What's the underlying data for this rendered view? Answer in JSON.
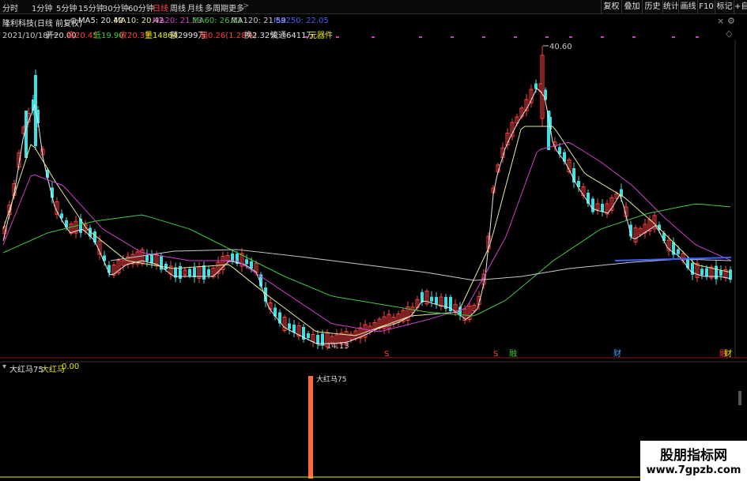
{
  "toolbar": {
    "timeframes": [
      {
        "label": "分时",
        "active": false
      },
      {
        "label": "1分钟",
        "active": false
      },
      {
        "label": "5分钟",
        "active": false
      },
      {
        "label": "15分钟",
        "active": false
      },
      {
        "label": "30分钟",
        "active": false
      },
      {
        "label": "60分钟",
        "active": false
      },
      {
        "label": "日线",
        "active": true
      },
      {
        "label": "周线",
        "active": false
      },
      {
        "label": "月线",
        "active": false
      },
      {
        "label": "多周期",
        "active": false
      },
      {
        "label": "更多",
        "active": false
      }
    ],
    "more_chevron": ">",
    "right_buttons": [
      "复权",
      "叠加",
      "历史",
      "统计",
      "画线",
      "F10",
      "标记",
      "+自"
    ]
  },
  "stock": {
    "name": "隆利科技(日线 前复权)",
    "ma": [
      {
        "label": "MA5: 20.42",
        "color": "#e8e8e8"
      },
      {
        "label": "MA10: 20.42",
        "color": "#e8e8a0"
      },
      {
        "label": "MA20: 21.13",
        "color": "#d040d0"
      },
      {
        "label": "MA60: 26.13",
        "color": "#40c840"
      },
      {
        "label": "MA120: 21.59",
        "color": "#c8c8c8"
      },
      {
        "label": "MA250: 22.05",
        "color": "#4060ff"
      }
    ]
  },
  "quote": {
    "date": "2021/10/18/一",
    "open": "开20.00",
    "high": "高20.45",
    "low": "低19.90",
    "close": "收20.37",
    "volume": "量14864",
    "amount": "额2999万",
    "change": "幅0.26(1.28%)",
    "turnover": "换2.32%",
    "float_shares": "流通6411万",
    "sector": "元器件"
  },
  "chart_data": {
    "type": "candlestick",
    "price_labels": {
      "high": "40.60",
      "low": "14.13"
    },
    "markers": [
      "S",
      "S",
      "融",
      "财",
      "融",
      "财"
    ],
    "indicator": {
      "name": "大红马75",
      "line_label": "大红马",
      "value": "0.00",
      "bar_annotation": "大红马75"
    }
  },
  "icons": {
    "close": "close-icon",
    "settings": "gear-icon",
    "expand": "expand-icon"
  },
  "watermark": {
    "title": "股朋指标网",
    "url": "www.7gpzb.com"
  }
}
